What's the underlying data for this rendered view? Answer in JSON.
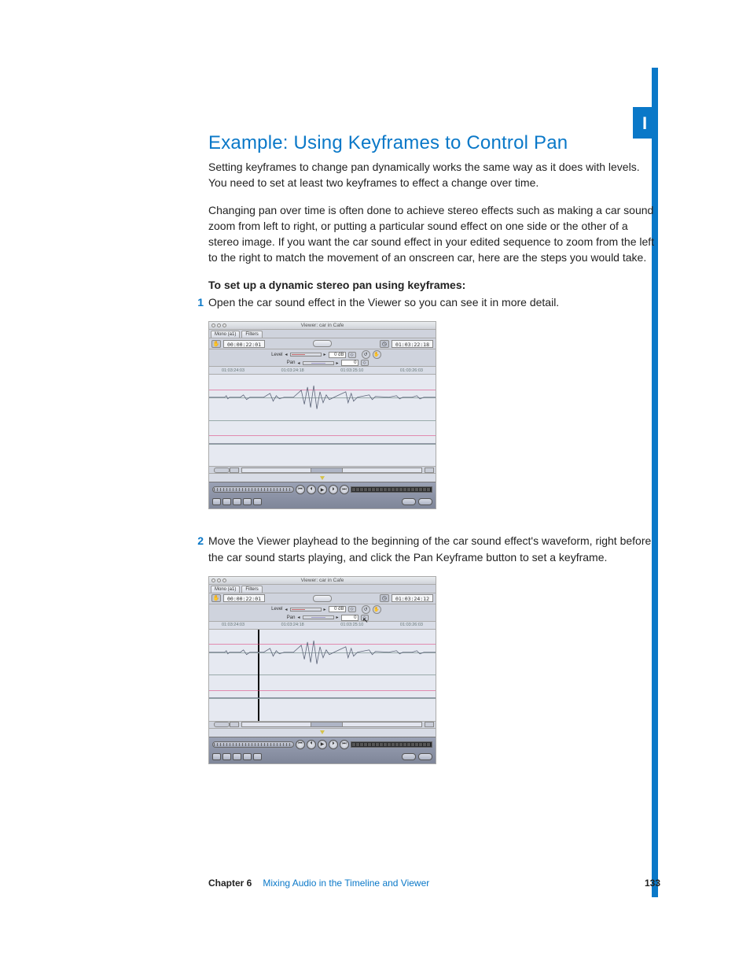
{
  "sidebar": {
    "letter": "I"
  },
  "heading": "Example:  Using Keyframes to Control Pan",
  "para1": "Setting keyframes to change pan dynamically works the same way as it does with levels. You need to set at least two keyframes to effect a change over time.",
  "para2": "Changing pan over time is often done to achieve stereo effects such as making a car sound zoom from left to right, or putting a particular sound effect on one side or the other of a stereo image. If you want the car sound effect in your edited sequence to zoom from the left to the right to match the movement of an onscreen car, here are the steps you would take.",
  "instr_label": "To set up a dynamic stereo pan using keyframes:",
  "steps": [
    {
      "n": "1",
      "text": "Open the car sound effect in the Viewer so you can see it in more detail."
    },
    {
      "n": "2",
      "text": "Move the Viewer playhead to the beginning of the car sound effect's waveform, right before the car sound starts playing, and click the Pan Keyframe button to set a keyframe."
    }
  ],
  "fig1": {
    "title": "Viewer: car in Cafe",
    "tabs": [
      "Mono (a1)",
      "Filters"
    ],
    "tc_left": "00:00:22:01",
    "tc_right": "01:03:22:18",
    "level_label": "Level",
    "pan_label": "Pan",
    "level_val": "0 dB",
    "pan_val": "0",
    "ruler": [
      "01:03:24:03",
      "01:03:24:18",
      "01:03:25:10",
      "01:03:26:03"
    ]
  },
  "fig2": {
    "title": "Viewer: car in Cafe",
    "tabs": [
      "Mono (a1)",
      "Filters"
    ],
    "tc_left": "00:00:22:01",
    "tc_right": "01:03:24:12",
    "level_label": "Level",
    "pan_label": "Pan",
    "level_val": "0 dB",
    "pan_val": "0",
    "ruler": [
      "01:03:24:03",
      "01:03:24:18",
      "01:03:25:10",
      "01:03:26:03"
    ]
  },
  "footer": {
    "chapter_label": "Chapter 6",
    "chapter_title": "Mixing Audio in the Timeline and Viewer",
    "page": "133"
  }
}
